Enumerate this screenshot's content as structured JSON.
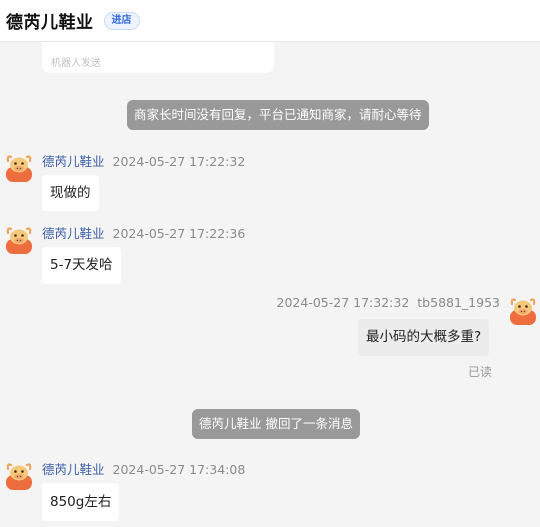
{
  "header": {
    "shop_name": "德芮儿鞋业",
    "enter_label": "进店"
  },
  "bot_card": {
    "text": "机器人发送"
  },
  "system_notice": "商家长时间没有回复，平台已通知商家，请耐心等待",
  "recall_notice": "德芮儿鞋业 撤回了一条消息",
  "messages": [
    {
      "sender": "德芮儿鞋业",
      "time": "2024-05-27 17:22:32",
      "text": "现做的"
    },
    {
      "sender": "德芮儿鞋业",
      "time": "2024-05-27 17:22:36",
      "text": "5-7天发哈"
    },
    {
      "sender": "tb5881_1953",
      "time": "2024-05-27 17:32:32",
      "text": "最小码的大概多重?",
      "status": "已读"
    },
    {
      "sender": "德芮儿鞋业",
      "time": "2024-05-27 17:34:08",
      "text": "850g左右"
    }
  ],
  "colors": {
    "background": "#f4f4f4",
    "system_pill": "#999999",
    "sender_name": "#3b5fa8",
    "avatar_main": "#ee6d3f",
    "avatar_head": "#f6c87a"
  },
  "icons": {
    "avatar": "cartoon-bull-avatar"
  }
}
